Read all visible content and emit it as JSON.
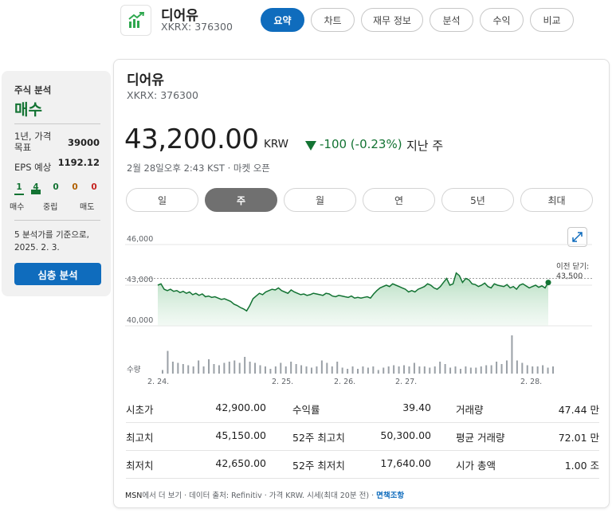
{
  "header": {
    "name": "디어유",
    "ticker": "XKRX: 376300",
    "icon": "stock-chart-icon",
    "tabs": [
      {
        "label": "요약",
        "active": true
      },
      {
        "label": "차트",
        "active": false
      },
      {
        "label": "재무 정보",
        "active": false
      },
      {
        "label": "분석",
        "active": false
      },
      {
        "label": "수익",
        "active": false
      },
      {
        "label": "비교",
        "active": false
      }
    ]
  },
  "analyst": {
    "title": "주식 분석",
    "recommendation": "매수",
    "target_label": "1년, 가격 목표",
    "target_value": "39000",
    "eps_label": "EPS 예상",
    "eps_value": "1192.12",
    "counts": [
      {
        "count": "1",
        "label": "매수",
        "color": "#137333"
      },
      {
        "count": "4",
        "label": "",
        "color": "#137333"
      },
      {
        "count": "0",
        "label": "중립",
        "color": "#137333"
      },
      {
        "count": "0",
        "label": "",
        "color": "#b06000"
      },
      {
        "count": "0",
        "label": "매도",
        "color": "#c5221f"
      }
    ],
    "note": "5 분석가를 기준으로, 2025. 2. 3.",
    "button": "심층 분석"
  },
  "quote": {
    "name": "디어유",
    "ticker": "XKRX: 376300",
    "price": "43,200.00",
    "currency": "KRW",
    "change": "-100 (-0.23%)",
    "period": "지난 주",
    "time": "2월 28일오후 2:43 KST · 마켓 오픈",
    "ranges": [
      {
        "label": "일",
        "active": false
      },
      {
        "label": "주",
        "active": true
      },
      {
        "label": "월",
        "active": false
      },
      {
        "label": "연",
        "active": false
      },
      {
        "label": "5년",
        "active": false
      },
      {
        "label": "최대",
        "active": false
      }
    ]
  },
  "chart_data": {
    "type": "area",
    "title": "",
    "xlabel": "",
    "ylabel": "",
    "ylim": [
      40000,
      46000
    ],
    "y_ticks": [
      "46,000",
      "43,000",
      "40,000"
    ],
    "x_tick_labels": [
      "2. 24.",
      "2. 25.",
      "2. 26.",
      "2. 27.",
      "2. 28."
    ],
    "previous_close_label": "이전 닫기:",
    "previous_close_value": "43,500",
    "previous_close": 43500,
    "volume_label": "수량",
    "series": [
      {
        "values": [
          43000,
          43100,
          42700,
          42600,
          42700,
          42550,
          42600,
          42450,
          42550,
          42400,
          42500,
          42300,
          42400,
          42250,
          42350,
          42150,
          42200,
          42100,
          42150,
          42050,
          41950,
          42000,
          41900,
          41800,
          41600,
          41500,
          41350,
          41250,
          41100,
          41500,
          42000,
          42200,
          42400,
          42300,
          42500,
          42600,
          42700,
          42650,
          42800,
          42600,
          42500,
          42400,
          42650,
          42500,
          42400,
          42300,
          42350,
          42250,
          42300,
          42400,
          42350,
          42300,
          42250,
          42400,
          42350,
          42200,
          42150,
          42250,
          42200,
          42150,
          42100,
          42200,
          42050,
          42100,
          42050,
          42100,
          42150,
          42050,
          42350,
          42600,
          42800,
          42900,
          43000,
          42900,
          43100,
          43000,
          42900,
          42800,
          42700,
          42500,
          42600,
          42500,
          42700,
          42800,
          42900,
          43100,
          43000,
          42800,
          42700,
          42900,
          43200,
          43500,
          43000,
          43100,
          43900,
          43700,
          43200,
          43500,
          43400,
          43100,
          43050,
          42900,
          43000,
          43150,
          42900,
          42800,
          43100,
          43000,
          42950,
          42900,
          43050,
          42800,
          42900,
          42700,
          43000,
          43100,
          42950,
          42800,
          42900,
          43000,
          42850,
          42950,
          42800,
          43200
        ]
      }
    ],
    "volume": [
      0.15,
      0.95,
      0.5,
      0.45,
      0.4,
      0.35,
      0.3,
      0.55,
      0.3,
      0.6,
      0.4,
      0.35,
      0.45,
      0.5,
      0.55,
      0.45,
      0.7,
      0.5,
      0.45,
      0.35,
      0.3,
      0.2,
      0.3,
      0.45,
      0.3,
      0.5,
      0.4,
      0.35,
      0.3,
      0.25,
      0.3,
      0.55,
      0.45,
      0.3,
      0.5,
      0.25,
      0.2,
      0.3,
      0.2,
      0.3,
      0.25,
      0.3,
      0.15,
      0.25,
      0.3,
      0.35,
      0.3,
      0.35,
      0.3,
      0.45,
      0.3,
      0.3,
      0.25,
      0.3,
      0.5,
      0.4,
      0.25,
      0.3,
      0.2,
      0.3,
      0.25,
      0.25,
      0.3,
      0.35,
      0.35,
      0.5,
      0.4,
      0.55,
      1.6,
      0.55,
      0.45,
      0.35,
      0.3,
      0.3,
      0.35,
      0.25,
      0.3
    ]
  },
  "stats": [
    [
      {
        "label": "시초가",
        "value": "42,900.00"
      },
      {
        "label": "수익률",
        "value": "39.40"
      },
      {
        "label": "거래량",
        "value": "47.44 만"
      }
    ],
    [
      {
        "label": "최고치",
        "value": "45,150.00"
      },
      {
        "label": "52주 최고치",
        "value": "50,300.00"
      },
      {
        "label": "평균 거래량",
        "value": "72.01 만"
      }
    ],
    [
      {
        "label": "최저치",
        "value": "42,650.00"
      },
      {
        "label": "52주 최저치",
        "value": "17,640.00"
      },
      {
        "label": "시가 총액",
        "value": "1.00 조"
      }
    ]
  ],
  "footer": {
    "msn": "MSN",
    "text": "에서 더 보기 · 데이터 출처: Refinitiv · 가격 KRW. 시세(최대 20분 전) · ",
    "link": "면책조항"
  },
  "colors": {
    "accent": "#0f6cbd",
    "up_green": "#137333",
    "line": "#137333",
    "area_fill": "#cfe8d6",
    "volume": "#9aa0a6"
  }
}
